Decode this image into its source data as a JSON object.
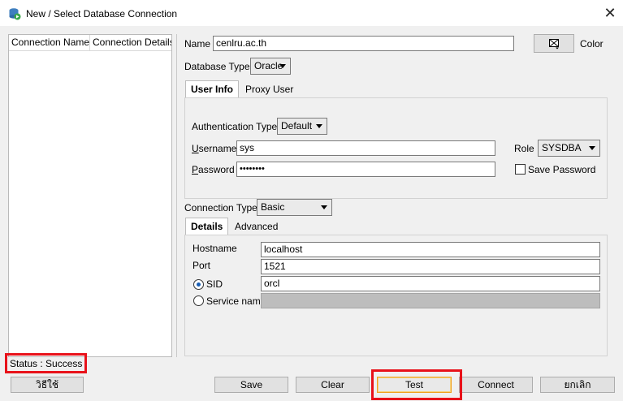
{
  "window": {
    "title": "New / Select Database Connection",
    "close_glyph": "✕",
    "app_icon": "sqldeveloper-db-icon"
  },
  "connection_list": {
    "columns": [
      "Connection Name",
      "Connection Details"
    ]
  },
  "form": {
    "name_label": "Name",
    "name_value": "cenlru.ac.th",
    "color_label": "Color",
    "database_type_label": "Database Type",
    "database_type_value": "Oracle",
    "tabs": [
      "User Info",
      "Proxy User"
    ],
    "active_tab": "User Info",
    "user_info": {
      "auth_type_label": "Authentication Type",
      "auth_type_value": "Default",
      "username_label": "Username",
      "username_value": "sys",
      "password_label": "Password",
      "password_value": "••••••••",
      "role_label": "Role",
      "role_value": "SYSDBA",
      "save_password_label": "Save Password",
      "save_password_checked": false
    },
    "connection_type_label": "Connection Type",
    "connection_type_value": "Basic",
    "conn_tabs": [
      "Details",
      "Advanced"
    ],
    "active_conn_tab": "Details",
    "details": {
      "hostname_label": "Hostname",
      "hostname_value": "localhost",
      "port_label": "Port",
      "port_value": "1521",
      "sid_label": "SID",
      "sid_value": "orcl",
      "service_name_label": "Service name",
      "service_name_value": "",
      "selected_option": "SID"
    }
  },
  "status": {
    "text": "Status : Success"
  },
  "buttons": {
    "help": "วิธีใช้",
    "save": "Save",
    "clear": "Clear",
    "test": "Test",
    "connect": "Connect",
    "cancel": "ยกเลิก"
  },
  "colors": {
    "highlight": "#e8121a",
    "focus_ring": "#f0a020",
    "dialog_bg": "#f0f0f0"
  }
}
